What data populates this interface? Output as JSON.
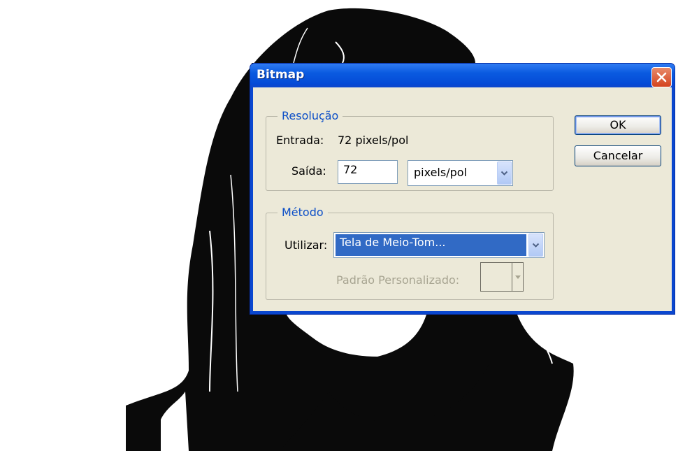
{
  "dialog": {
    "title": "Bitmap",
    "close_icon": "close-icon",
    "resolution": {
      "legend": "Resolução",
      "input_label": "Entrada:",
      "input_value": "72 pixels/pol",
      "output_label": "Saída:",
      "output_value": "72",
      "output_unit": "pixels/pol"
    },
    "method": {
      "legend": "Método",
      "use_label": "Utilizar:",
      "use_value": "Tela de Meio-Tom...",
      "custom_pattern_label": "Padrão Personalizado:"
    },
    "ok_label": "OK",
    "cancel_label": "Cancelar"
  },
  "colors": {
    "title_bar": "#0a5ae0",
    "dialog_face": "#ece9d8",
    "group_title": "#0b4ec7",
    "selection": "#316ac5",
    "close_button": "#d4431e"
  }
}
